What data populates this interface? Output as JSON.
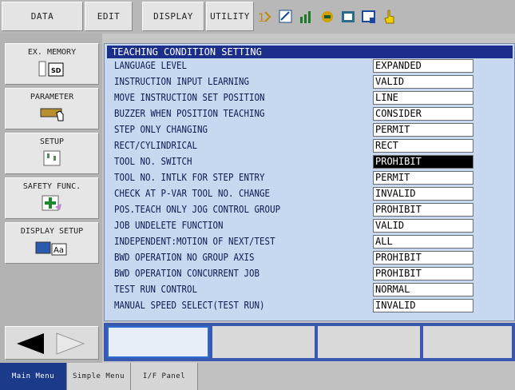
{
  "topmenu": {
    "data": "DATA",
    "edit": "EDIT",
    "display": "DISPLAY",
    "utility": "UTILITY"
  },
  "sidebar": {
    "items": [
      {
        "label": "EX. MEMORY",
        "icon": "sd-card-icon"
      },
      {
        "label": "PARAMETER",
        "icon": "parameter-icon"
      },
      {
        "label": "SETUP",
        "icon": "setup-icon"
      },
      {
        "label": "SAFETY FUNC.",
        "icon": "safety-icon"
      },
      {
        "label": "DISPLAY SETUP",
        "icon": "display-setup-icon"
      }
    ]
  },
  "main": {
    "title": "TEACHING CONDITION SETTING",
    "rows": [
      {
        "label": "LANGUAGE LEVEL",
        "value": "EXPANDED"
      },
      {
        "label": "INSTRUCTION INPUT LEARNING",
        "value": "VALID"
      },
      {
        "label": "MOVE INSTRUCTION SET POSITION",
        "value": "LINE"
      },
      {
        "label": "BUZZER WHEN POSITION TEACHING",
        "value": "CONSIDER"
      },
      {
        "label": "STEP ONLY CHANGING",
        "value": "PERMIT"
      },
      {
        "label": "RECT/CYLINDRICAL",
        "value": "RECT"
      },
      {
        "label": "TOOL NO. SWITCH",
        "value": "PROHIBIT"
      },
      {
        "label": "TOOL NO. INTLK FOR STEP ENTRY",
        "value": "PERMIT"
      },
      {
        "label": "CHECK AT P-VAR TOOL NO. CHANGE",
        "value": "INVALID"
      },
      {
        "label": "POS.TEACH ONLY JOG CONTROL GROUP",
        "value": "PROHIBIT"
      },
      {
        "label": "JOB UNDELETE FUNCTION",
        "value": "VALID"
      },
      {
        "label": "INDEPENDENT:MOTION OF NEXT/TEST",
        "value": "ALL"
      },
      {
        "label": "BWD OPERATION NO GROUP AXIS",
        "value": "PROHIBIT"
      },
      {
        "label": "BWD OPERATION CONCURRENT JOB",
        "value": "PROHIBIT"
      },
      {
        "label": "TEST RUN CONTROL",
        "value": "NORMAL"
      },
      {
        "label": "MANUAL SPEED SELECT(TEST RUN)",
        "value": "INVALID"
      }
    ],
    "selected_row": 6
  },
  "bottom_tabs": {
    "main_menu": "Main Menu",
    "simple_menu": "Simple Menu",
    "if_panel": "I/F Panel"
  },
  "colors": {
    "title_bar": "#1b2f8a",
    "panel_bg": "#c6d9f1",
    "active_tab": "#1b3a8a"
  }
}
